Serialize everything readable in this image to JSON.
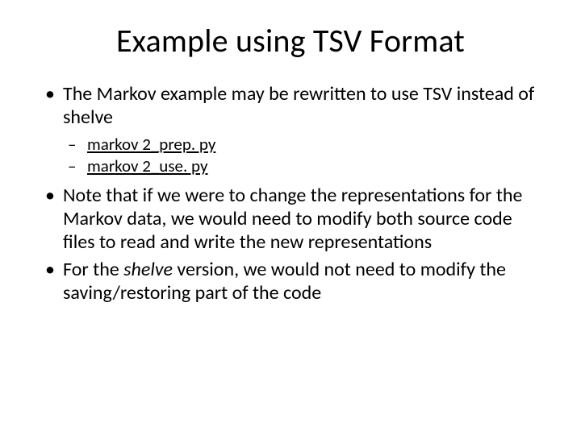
{
  "title": "Example using TSV Format",
  "bullets": {
    "b1": "The Markov example may be rewritten to use TSV instead of shelve",
    "sub1": "markov 2_prep. py",
    "sub2": "markov 2_use. py",
    "b2": "Note that if we were to change the representations for the Markov data, we would need to modify both source code files to read and write the new representations",
    "b3_a": "For the ",
    "b3_i": "shelve",
    "b3_b": " version, we would not need to modify the saving/restoring part of the code"
  }
}
